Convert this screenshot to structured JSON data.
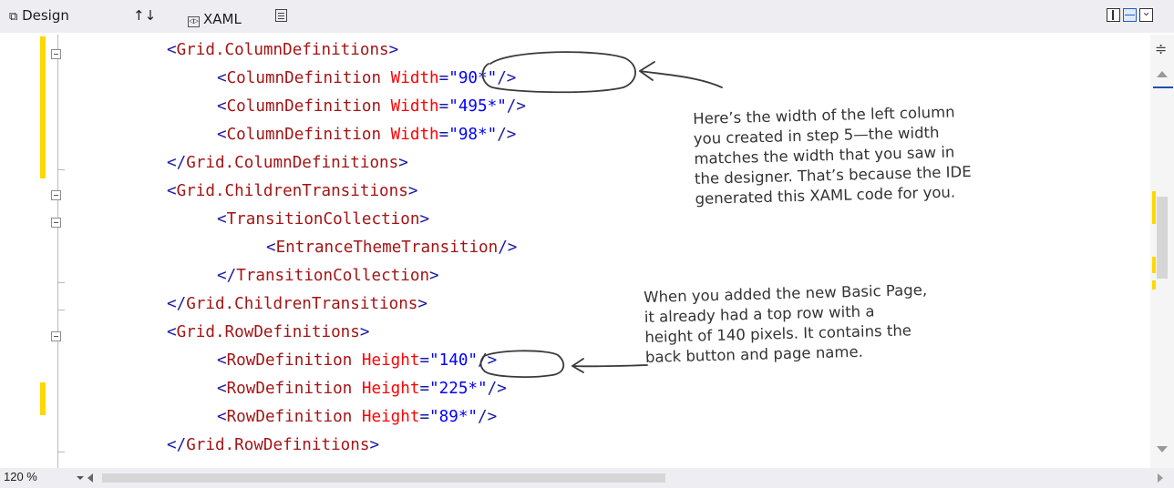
{
  "tabs": {
    "design_label": "Design",
    "design_icon": "design-view-icon",
    "swap_label": "↑↓",
    "xaml_label": "XAML",
    "xaml_icon": "xaml-file-icon",
    "document_outline_icon": "document-outline-icon"
  },
  "view_buttons": [
    "vertical-split-icon",
    "horizontal-split-icon",
    "collapse-pane-icon"
  ],
  "code": [
    [
      [
        "pun",
        "<"
      ],
      [
        "tag",
        "Grid.ColumnDefinitions"
      ],
      [
        "pun",
        ">"
      ]
    ],
    [
      [
        "pun",
        "<"
      ],
      [
        "tag",
        "ColumnDefinition"
      ],
      [
        "pun",
        " "
      ],
      [
        "att",
        "Width"
      ],
      [
        "pun",
        "="
      ],
      [
        "val",
        "\"90*\""
      ],
      [
        "pun",
        "/>"
      ]
    ],
    [
      [
        "pun",
        "<"
      ],
      [
        "tag",
        "ColumnDefinition"
      ],
      [
        "pun",
        " "
      ],
      [
        "att",
        "Width"
      ],
      [
        "pun",
        "="
      ],
      [
        "val",
        "\"495*\""
      ],
      [
        "pun",
        "/>"
      ]
    ],
    [
      [
        "pun",
        "<"
      ],
      [
        "tag",
        "ColumnDefinition"
      ],
      [
        "pun",
        " "
      ],
      [
        "att",
        "Width"
      ],
      [
        "pun",
        "="
      ],
      [
        "val",
        "\"98*\""
      ],
      [
        "pun",
        "/>"
      ]
    ],
    [
      [
        "pun",
        "</"
      ],
      [
        "tag",
        "Grid.ColumnDefinitions"
      ],
      [
        "pun",
        ">"
      ]
    ],
    [
      [
        "pun",
        "<"
      ],
      [
        "tag",
        "Grid.ChildrenTransitions"
      ],
      [
        "pun",
        ">"
      ]
    ],
    [
      [
        "pun",
        "<"
      ],
      [
        "tag",
        "TransitionCollection"
      ],
      [
        "pun",
        ">"
      ]
    ],
    [
      [
        "pun",
        "<"
      ],
      [
        "tag",
        "EntranceThemeTransition"
      ],
      [
        "pun",
        "/>"
      ]
    ],
    [
      [
        "pun",
        "</"
      ],
      [
        "tag",
        "TransitionCollection"
      ],
      [
        "pun",
        ">"
      ]
    ],
    [
      [
        "pun",
        "</"
      ],
      [
        "tag",
        "Grid.ChildrenTransitions"
      ],
      [
        "pun",
        ">"
      ]
    ],
    [
      [
        "pun",
        "<"
      ],
      [
        "tag",
        "Grid.RowDefinitions"
      ],
      [
        "pun",
        ">"
      ]
    ],
    [
      [
        "pun",
        "<"
      ],
      [
        "tag",
        "RowDefinition"
      ],
      [
        "pun",
        " "
      ],
      [
        "att",
        "Height"
      ],
      [
        "pun",
        "="
      ],
      [
        "val",
        "\"140\""
      ],
      [
        "pun",
        "/>"
      ]
    ],
    [
      [
        "pun",
        "<"
      ],
      [
        "tag",
        "RowDefinition"
      ],
      [
        "pun",
        " "
      ],
      [
        "att",
        "Height"
      ],
      [
        "pun",
        "="
      ],
      [
        "val",
        "\"225*\""
      ],
      [
        "pun",
        "/>"
      ]
    ],
    [
      [
        "pun",
        "<"
      ],
      [
        "tag",
        "RowDefinition"
      ],
      [
        "pun",
        " "
      ],
      [
        "att",
        "Height"
      ],
      [
        "pun",
        "="
      ],
      [
        "val",
        "\"89*\""
      ],
      [
        "pun",
        "/>"
      ]
    ],
    [
      [
        "pun",
        "</"
      ],
      [
        "tag",
        "Grid.RowDefinitions"
      ],
      [
        "pun",
        ">"
      ]
    ]
  ],
  "annotations": {
    "column_width_note": "Here’s the width of the left column\nyou created in step 5—the width\nmatches the width that you saw in\nthe designer. That’s because the IDE\ngenerated this XAML code for you.",
    "row_height_note": "When you added the new Basic Page,\nit already had a top row with a\nheight of 140 pixels. It contains the\nback button and page name."
  },
  "status": {
    "zoom_level": "120 %"
  },
  "colors": {
    "punctuation": "#1a1aa6",
    "element": "#a31515",
    "attribute": "#ff0000",
    "value": "#0000ff",
    "change_marker": "#ffd800"
  }
}
